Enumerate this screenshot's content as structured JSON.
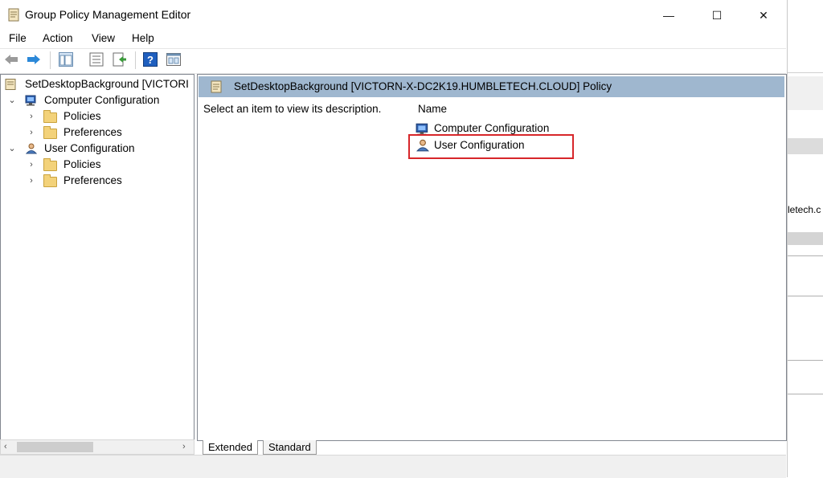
{
  "window": {
    "title": "Group Policy Management Editor",
    "minimize": "—",
    "maximize": "☐",
    "close": "✕"
  },
  "menu": [
    "File",
    "Action",
    "View",
    "Help"
  ],
  "toolbar": {
    "icons": [
      "back-arrow-icon",
      "forward-arrow-icon",
      "show-tree-icon",
      "properties-icon",
      "export-icon",
      "help-icon",
      "console-icon"
    ]
  },
  "tree": {
    "root": "SetDesktopBackground [VICTORI",
    "nodes": [
      {
        "label": "Computer Configuration",
        "children": [
          "Policies",
          "Preferences"
        ]
      },
      {
        "label": "User Configuration",
        "children": [
          "Policies",
          "Preferences"
        ]
      }
    ]
  },
  "details": {
    "header": "SetDesktopBackground [VICTORN-X-DC2K19.HUMBLETECH.CLOUD] Policy",
    "description": "Select an item to view its description.",
    "column_name": "Name",
    "items": [
      "Computer Configuration",
      "User Configuration"
    ]
  },
  "tabs": [
    "Extended",
    "Standard"
  ],
  "background_app": {
    "text": "letech.c"
  },
  "colors": {
    "header_bg": "#9fb7cf",
    "highlight": "#d7262a",
    "folder": "#f3d27a"
  }
}
